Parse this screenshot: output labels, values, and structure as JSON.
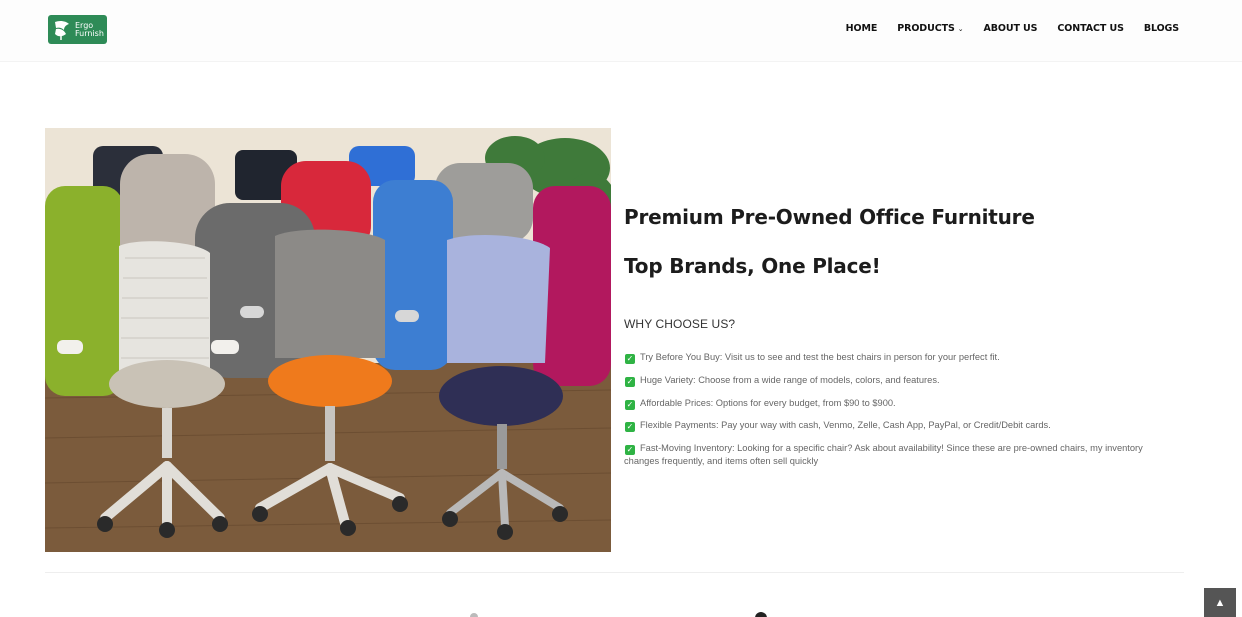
{
  "header": {
    "logo": {
      "line1": "Ergo",
      "line2": "Furnish",
      "icon": "chair-leaf-logo-icon",
      "color": "#2e8b57"
    },
    "nav": [
      {
        "label": "HOME"
      },
      {
        "label": "PRODUCTS",
        "icon": "chevron-down-icon"
      },
      {
        "label": "ABOUT US"
      },
      {
        "label": "CONTACT US"
      },
      {
        "label": "BLOGS"
      }
    ]
  },
  "hero": {
    "image_alt": "Assorted pre-owned office chairs",
    "headline_1": "Premium Pre-Owned Office Furniture",
    "headline_2": "Top Brands, One Place!",
    "why_title": "WHY CHOOSE US?",
    "check_icon": "check-square-icon",
    "check_color": "#2fb344",
    "features": [
      "Try Before You Buy: Visit us to see and test the best chairs in person for your perfect fit.",
      "Huge Variety: Choose from a wide range of models, colors, and features.",
      "Affordable Prices: Options for every budget, from $90 to $900.",
      "Flexible Payments: Pay your way with cash, Venmo, Zelle, Cash App, PayPal, or Credit/Debit cards.",
      "Fast-Moving Inventory: Looking for a specific chair? Ask about availability! Since these are pre-owned chairs, my inventory changes frequently, and items often sell quickly"
    ]
  },
  "scroll_top": {
    "icon": "chevron-up-icon"
  }
}
